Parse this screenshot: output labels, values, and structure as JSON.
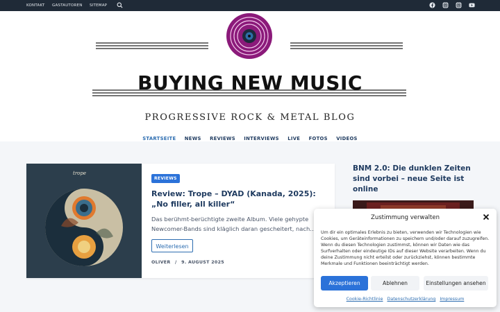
{
  "topbar": {
    "links": [
      "KONTAKT",
      "GASTAUTOREN",
      "SITEMAP"
    ],
    "search_icon": "search-icon",
    "social_icons": [
      "facebook-icon",
      "instagram-icon",
      "instagram-icon",
      "youtube-icon"
    ]
  },
  "header": {
    "logo_title": "BUYING NEW MUSIC",
    "logo_subtitle": "PROGRESSIVE ROCK & METAL BLOG",
    "logo_icon": "vinyl-record-icon"
  },
  "nav": {
    "items": [
      "STARTSEITE",
      "NEWS",
      "REVIEWS",
      "INTERVIEWS",
      "LIVE",
      "FOTOS",
      "VIDEOS"
    ]
  },
  "post": {
    "category": "REVIEWS",
    "title": "Review: Trope – DYAD (Kanada, 2025): „No filler, all killer“",
    "excerpt": "Das berühmt-berüchtigte zweite Album. Viele gehypte Newcomer-Bands sind kläglich daran gescheitert, nach…",
    "read_more": "Weiterlesen",
    "author": "OLIVER",
    "separator": "/",
    "date": "9. AUGUST 2025",
    "cover_text": "trope"
  },
  "sidebar": {
    "title": "BNM 2.0: Die dunklen Zeiten sind vorbei – neue Seite ist online"
  },
  "consent": {
    "title": "Zustimmung verwalten",
    "text": "Um dir ein optimales Erlebnis zu bieten, verwenden wir Technologien wie Cookies, um Geräteinformationen zu speichern und/oder darauf zuzugreifen. Wenn du diesen Technologien zustimmst, können wir Daten wie das Surfverhalten oder eindeutige IDs auf dieser Website verarbeiten. Wenn du deine Zustimmung nicht erteilst oder zurückziehst, können bestimmte Merkmale und Funktionen beeinträchtigt werden.",
    "accept": "Akzeptieren",
    "deny": "Ablehnen",
    "settings": "Einstellungen ansehen",
    "links": [
      "Cookie-Richtlinie",
      "Datenschutzerklärung",
      "Impressum"
    ]
  },
  "colors": {
    "topbar": "#1f2a37",
    "accent": "#2b72d9",
    "logo_purple": "#8b1a7a",
    "heading": "#1e3a5f"
  }
}
